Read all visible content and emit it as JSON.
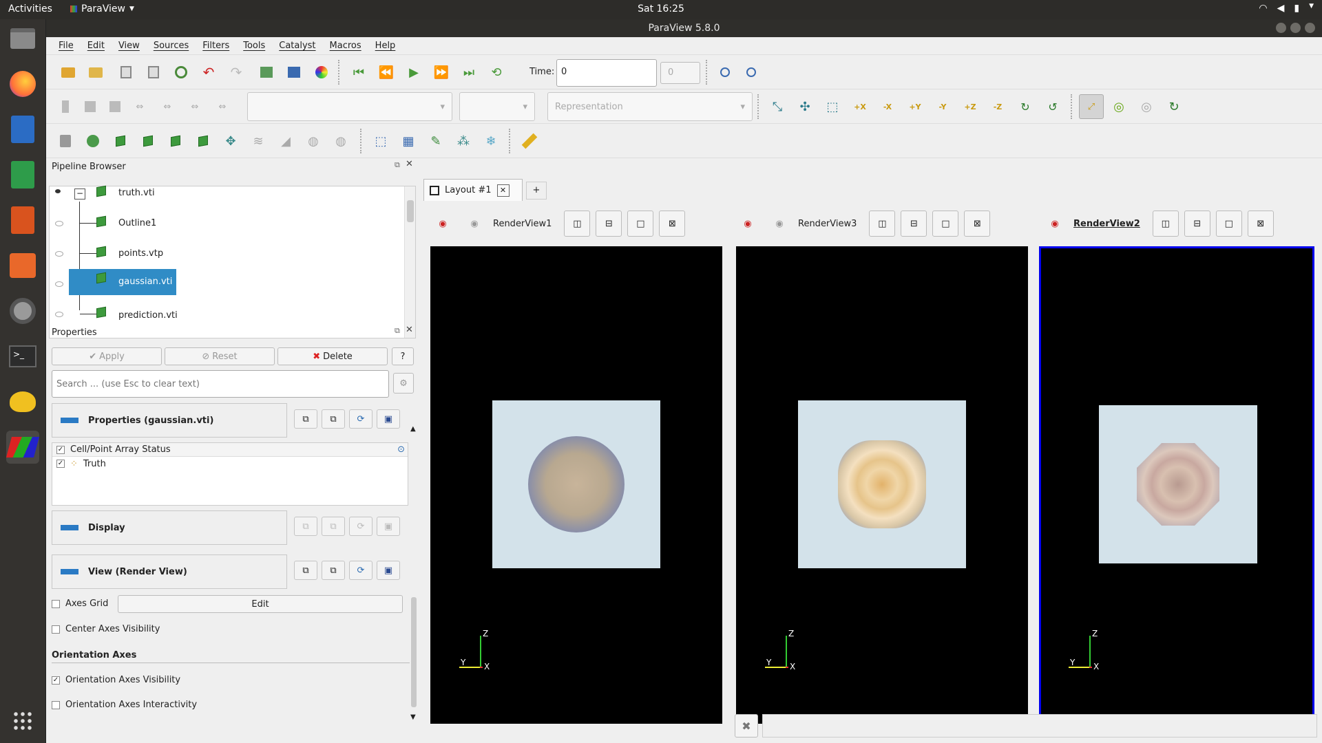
{
  "topbar": {
    "activities": "Activities",
    "app_name": "ParaView",
    "clock": "Sat 16:25"
  },
  "window": {
    "title": "ParaView 5.8.0"
  },
  "menu": [
    "File",
    "Edit",
    "View",
    "Sources",
    "Filters",
    "Tools",
    "Catalyst",
    "Macros",
    "Help"
  ],
  "toolbar": {
    "time_label": "Time:",
    "time_value": "0",
    "time_step": "0",
    "representation_placeholder": "Representation"
  },
  "pipeline": {
    "title": "Pipeline Browser",
    "items": [
      {
        "label": "truth.vti"
      },
      {
        "label": "Outline1"
      },
      {
        "label": "points.vtp"
      },
      {
        "label": "gaussian.vti",
        "selected": true
      },
      {
        "label": "prediction.vti"
      }
    ]
  },
  "properties": {
    "title": "Properties",
    "apply": "Apply",
    "reset": "Reset",
    "delete": "Delete",
    "help": "?",
    "search_placeholder": "Search ... (use Esc to clear text)",
    "section_props": "Properties (gaussian.vti)",
    "array_status_header": "Cell/Point Array Status",
    "array_item": "Truth",
    "section_display": "Display",
    "section_view": "View (Render View)",
    "axes_grid": "Axes Grid",
    "edit": "Edit",
    "center_axes": "Center Axes Visibility",
    "orientation_header": "Orientation Axes",
    "orientation_visibility": "Orientation Axes Visibility",
    "orientation_interactivity": "Orientation Axes Interactivity"
  },
  "layout": {
    "tab": "Layout #1",
    "add_tab": "+"
  },
  "views": [
    {
      "name": "RenderView1",
      "active": false
    },
    {
      "name": "RenderView3",
      "active": false
    },
    {
      "name": "RenderView2",
      "active": true
    }
  ],
  "axes_labels": {
    "z": "Z",
    "y": "Y",
    "x": "X"
  },
  "colors": {
    "selection": "#308cc6",
    "active_view_border": "#0000ee",
    "section_bar": "#2a7ac4",
    "dock_bg": "#34322f"
  }
}
